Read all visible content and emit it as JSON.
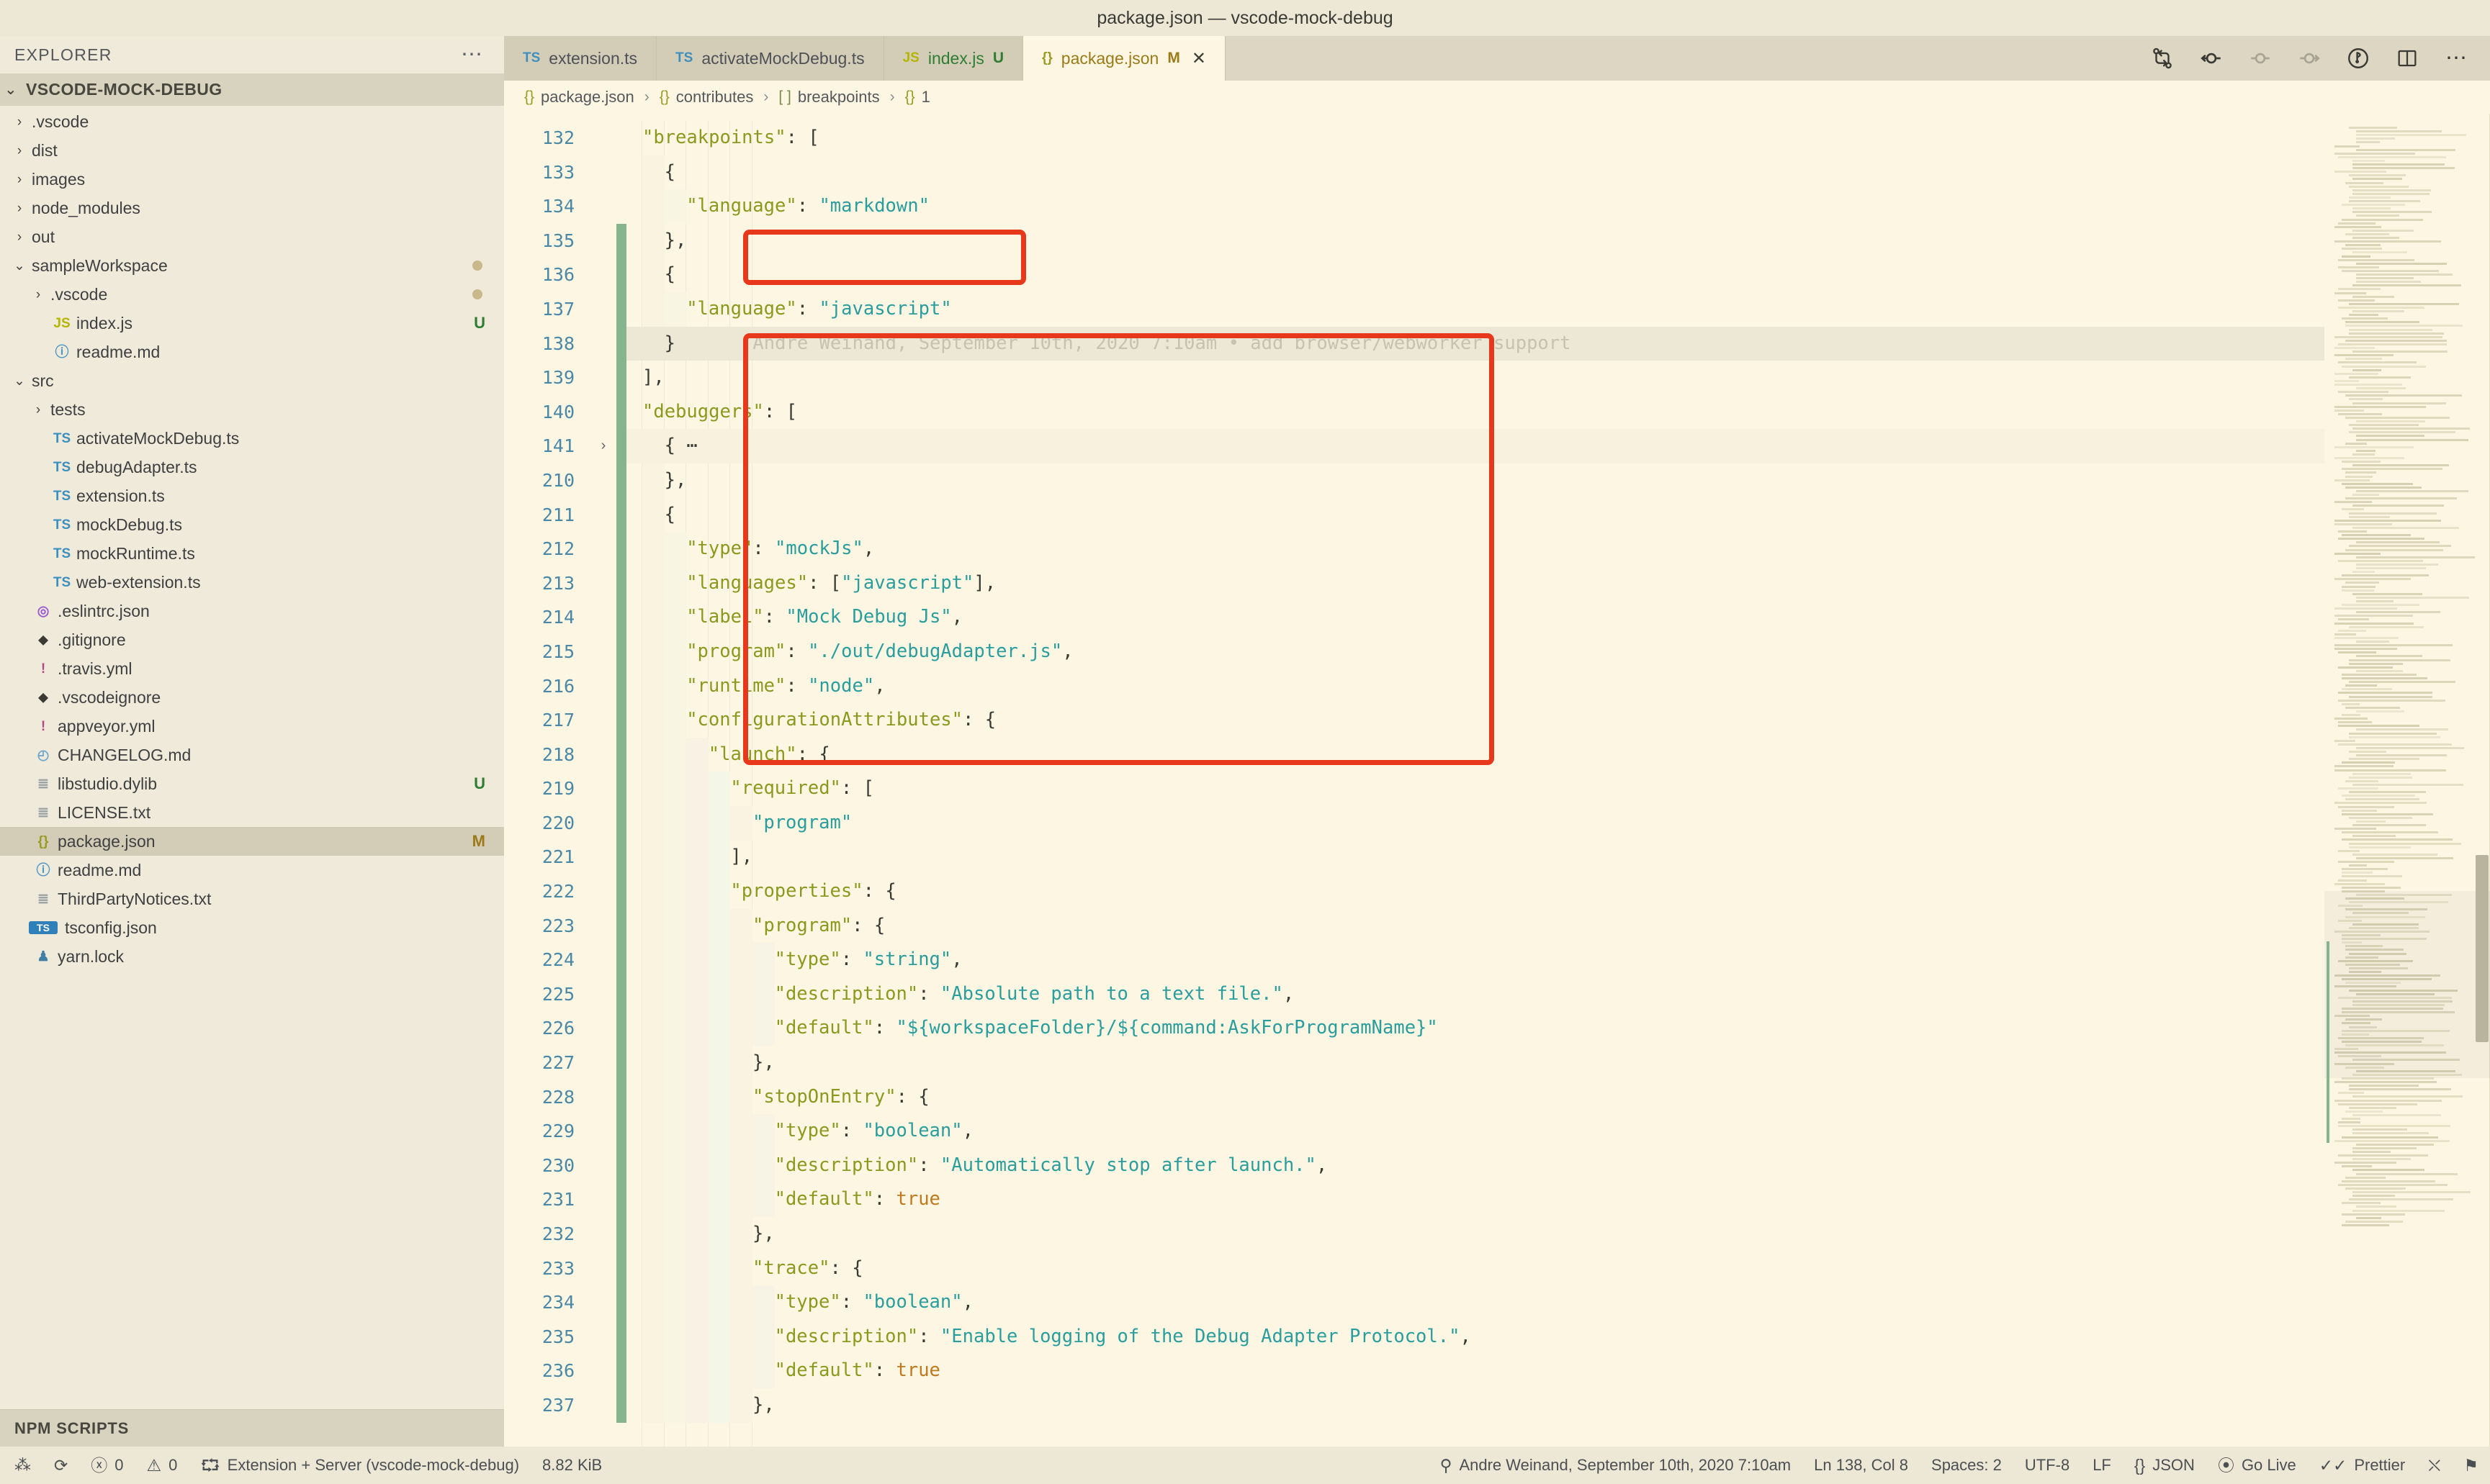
{
  "window": {
    "title": "package.json — vscode-mock-debug"
  },
  "sidebar": {
    "header": {
      "title": "EXPLORER",
      "more_icon": "ellipsis-icon"
    },
    "root": {
      "label": "VSCODE-MOCK-DEBUG",
      "twisty": "⌄"
    },
    "items": [
      {
        "twisty": "›",
        "icon": "folder-icon",
        "icon_glyph": "",
        "label": ".vscode",
        "indent": 0,
        "badge": ""
      },
      {
        "twisty": "›",
        "icon": "folder-icon",
        "icon_glyph": "",
        "label": "dist",
        "indent": 0,
        "badge": ""
      },
      {
        "twisty": "›",
        "icon": "folder-icon",
        "icon_glyph": "",
        "label": "images",
        "indent": 0,
        "badge": ""
      },
      {
        "twisty": "›",
        "icon": "folder-icon",
        "icon_glyph": "",
        "label": "node_modules",
        "indent": 0,
        "badge": ""
      },
      {
        "twisty": "›",
        "icon": "folder-icon",
        "icon_glyph": "",
        "label": "out",
        "indent": 0,
        "badge": ""
      },
      {
        "twisty": "⌄",
        "icon": "folder-icon",
        "icon_glyph": "",
        "label": "sampleWorkspace",
        "indent": 0,
        "badge": "dot"
      },
      {
        "twisty": "›",
        "icon": "folder-icon",
        "icon_glyph": "",
        "label": ".vscode",
        "indent": 1,
        "badge": "dot"
      },
      {
        "twisty": "",
        "icon": "js-file-icon",
        "icon_glyph": "JS",
        "label": "index.js",
        "indent": 1,
        "badge": "U"
      },
      {
        "twisty": "",
        "icon": "markdown-file-icon",
        "icon_glyph": "ⓘ",
        "label": "readme.md",
        "indent": 1,
        "badge": ""
      },
      {
        "twisty": "⌄",
        "icon": "folder-icon",
        "icon_glyph": "",
        "label": "src",
        "indent": 0,
        "badge": ""
      },
      {
        "twisty": "›",
        "icon": "folder-icon",
        "icon_glyph": "",
        "label": "tests",
        "indent": 1,
        "badge": ""
      },
      {
        "twisty": "",
        "icon": "typescript-file-icon",
        "icon_glyph": "TS",
        "label": "activateMockDebug.ts",
        "indent": 1,
        "badge": ""
      },
      {
        "twisty": "",
        "icon": "typescript-file-icon",
        "icon_glyph": "TS",
        "label": "debugAdapter.ts",
        "indent": 1,
        "badge": ""
      },
      {
        "twisty": "",
        "icon": "typescript-file-icon",
        "icon_glyph": "TS",
        "label": "extension.ts",
        "indent": 1,
        "badge": ""
      },
      {
        "twisty": "",
        "icon": "typescript-file-icon",
        "icon_glyph": "TS",
        "label": "mockDebug.ts",
        "indent": 1,
        "badge": ""
      },
      {
        "twisty": "",
        "icon": "typescript-file-icon",
        "icon_glyph": "TS",
        "label": "mockRuntime.ts",
        "indent": 1,
        "badge": ""
      },
      {
        "twisty": "",
        "icon": "typescript-file-icon",
        "icon_glyph": "TS",
        "label": "web-extension.ts",
        "indent": 1,
        "badge": ""
      },
      {
        "twisty": "",
        "icon": "eslint-file-icon",
        "icon_glyph": "◎",
        "label": ".eslintrc.json",
        "indent": 0,
        "badge": ""
      },
      {
        "twisty": "",
        "icon": "git-file-icon",
        "icon_glyph": "⬥",
        "label": ".gitignore",
        "indent": 0,
        "badge": ""
      },
      {
        "twisty": "",
        "icon": "yaml-file-icon",
        "icon_glyph": "!",
        "label": ".travis.yml",
        "indent": 0,
        "badge": ""
      },
      {
        "twisty": "",
        "icon": "git-file-icon",
        "icon_glyph": "⬥",
        "label": ".vscodeignore",
        "indent": 0,
        "badge": ""
      },
      {
        "twisty": "",
        "icon": "yaml-file-icon",
        "icon_glyph": "!",
        "label": "appveyor.yml",
        "indent": 0,
        "badge": ""
      },
      {
        "twisty": "",
        "icon": "changelog-file-icon",
        "icon_glyph": "◴",
        "label": "CHANGELOG.md",
        "indent": 0,
        "badge": ""
      },
      {
        "twisty": "",
        "icon": "binary-file-icon",
        "icon_glyph": "≣",
        "label": "libstudio.dylib",
        "indent": 0,
        "badge": "U"
      },
      {
        "twisty": "",
        "icon": "text-file-icon",
        "icon_glyph": "≣",
        "label": "LICENSE.txt",
        "indent": 0,
        "badge": ""
      },
      {
        "twisty": "",
        "icon": "json-file-icon",
        "icon_glyph": "{}",
        "label": "package.json",
        "indent": 0,
        "badge": "M"
      },
      {
        "twisty": "",
        "icon": "markdown-file-icon",
        "icon_glyph": "ⓘ",
        "label": "readme.md",
        "indent": 0,
        "badge": ""
      },
      {
        "twisty": "",
        "icon": "text-file-icon",
        "icon_glyph": "≣",
        "label": "ThirdPartyNotices.txt",
        "indent": 0,
        "badge": ""
      },
      {
        "twisty": "",
        "icon": "tsconfig-file-icon",
        "icon_glyph": "TS",
        "label": "tsconfig.json",
        "indent": 0,
        "badge": ""
      },
      {
        "twisty": "",
        "icon": "yarn-file-icon",
        "icon_glyph": "♟",
        "label": "yarn.lock",
        "indent": 0,
        "badge": ""
      }
    ],
    "npm_scripts": {
      "label": "NPM SCRIPTS"
    }
  },
  "tabs": [
    {
      "icon": "typescript-file-icon",
      "icon_glyph": "TS",
      "label": "extension.ts",
      "modifier": "",
      "active": false,
      "closable": false
    },
    {
      "icon": "typescript-file-icon",
      "icon_glyph": "TS",
      "label": "activateMockDebug.ts",
      "modifier": "",
      "active": false,
      "closable": false
    },
    {
      "icon": "js-file-icon",
      "icon_glyph": "JS",
      "label": "index.js",
      "modifier": "U",
      "active": false,
      "closable": false
    },
    {
      "icon": "json-file-icon",
      "icon_glyph": "{}",
      "label": "package.json",
      "modifier": "M",
      "active": true,
      "closable": true,
      "close_glyph": "✕"
    }
  ],
  "editor_actions": [
    {
      "name": "compare-changes-icon"
    },
    {
      "name": "previous-change-icon"
    },
    {
      "name": "current-change-icon"
    },
    {
      "name": "next-change-icon"
    },
    {
      "name": "toggle-blame-icon"
    },
    {
      "name": "split-editor-icon"
    },
    {
      "name": "more-actions-icon"
    }
  ],
  "breadcrumbs": [
    {
      "icon_glyph": "{}",
      "label": "package.json",
      "kind": "json"
    },
    {
      "icon_glyph": "{}",
      "label": "contributes",
      "kind": "json"
    },
    {
      "icon_glyph": "[ ]",
      "label": "breakpoints",
      "kind": "array"
    },
    {
      "icon_glyph": "{}",
      "label": "1",
      "kind": "json"
    }
  ],
  "breadcrumb_separator": "›",
  "editor": {
    "file": "package.json",
    "language": "JSON",
    "first_line": 132,
    "lines": [
      {
        "n": 132,
        "indent": 1,
        "text": "\"breakpoints\": ["
      },
      {
        "n": 133,
        "indent": 2,
        "text": "{"
      },
      {
        "n": 134,
        "indent": 3,
        "text": "\"language\": \"markdown\""
      },
      {
        "n": 135,
        "indent": 2,
        "text": "},"
      },
      {
        "n": 136,
        "indent": 2,
        "text": "{"
      },
      {
        "n": 137,
        "indent": 3,
        "text": "\"language\": \"javascript\""
      },
      {
        "n": 138,
        "indent": 2,
        "text": "}"
      },
      {
        "n": 139,
        "indent": 1,
        "text": "],"
      },
      {
        "n": 140,
        "indent": 1,
        "text": "\"debuggers\": ["
      },
      {
        "n": 141,
        "indent": 2,
        "text": "{ ⋯"
      },
      {
        "n": 210,
        "indent": 2,
        "text": "},"
      },
      {
        "n": 211,
        "indent": 2,
        "text": "{"
      },
      {
        "n": 212,
        "indent": 3,
        "text": "\"type\": \"mockJs\","
      },
      {
        "n": 213,
        "indent": 3,
        "text": "\"languages\": [\"javascript\"],"
      },
      {
        "n": 214,
        "indent": 3,
        "text": "\"label\": \"Mock Debug Js\","
      },
      {
        "n": 215,
        "indent": 3,
        "text": "\"program\": \"./out/debugAdapter.js\","
      },
      {
        "n": 216,
        "indent": 3,
        "text": "\"runtime\": \"node\","
      },
      {
        "n": 217,
        "indent": 3,
        "text": "\"configurationAttributes\": {"
      },
      {
        "n": 218,
        "indent": 4,
        "text": "\"launch\": {"
      },
      {
        "n": 219,
        "indent": 5,
        "text": "\"required\": ["
      },
      {
        "n": 220,
        "indent": 6,
        "text": "\"program\""
      },
      {
        "n": 221,
        "indent": 5,
        "text": "],"
      },
      {
        "n": 222,
        "indent": 5,
        "text": "\"properties\": {"
      },
      {
        "n": 223,
        "indent": 6,
        "text": "\"program\": {"
      },
      {
        "n": 224,
        "indent": 7,
        "text": "\"type\": \"string\","
      },
      {
        "n": 225,
        "indent": 7,
        "text": "\"description\": \"Absolute path to a text file.\","
      },
      {
        "n": 226,
        "indent": 7,
        "text": "\"default\": \"${workspaceFolder}/${command:AskForProgramName}\""
      },
      {
        "n": 227,
        "indent": 6,
        "text": "},"
      },
      {
        "n": 228,
        "indent": 6,
        "text": "\"stopOnEntry\": {"
      },
      {
        "n": 229,
        "indent": 7,
        "text": "\"type\": \"boolean\","
      },
      {
        "n": 230,
        "indent": 7,
        "text": "\"description\": \"Automatically stop after launch.\","
      },
      {
        "n": 231,
        "indent": 7,
        "text": "\"default\": true"
      },
      {
        "n": 232,
        "indent": 6,
        "text": "},"
      },
      {
        "n": 233,
        "indent": 6,
        "text": "\"trace\": {"
      },
      {
        "n": 234,
        "indent": 7,
        "text": "\"type\": \"boolean\","
      },
      {
        "n": 235,
        "indent": 7,
        "text": "\"description\": \"Enable logging of the Debug Adapter Protocol.\","
      },
      {
        "n": 236,
        "indent": 7,
        "text": "\"default\": true"
      },
      {
        "n": 237,
        "indent": 6,
        "text": "},"
      }
    ],
    "blame_annotation": {
      "line": 138,
      "text": "Andre Weinand, September 10th, 2020 7:10am • add browser/webworker support"
    },
    "fold_marker_line": 141,
    "fold_glyph": "›"
  },
  "annotations": {
    "box1_label": "breakpoints-javascript-entry",
    "box2_label": "mockJs-debugger-entry",
    "color": "#E8381B"
  },
  "statusbar": {
    "left": [
      {
        "name": "remote-indicator-icon",
        "glyph": "⁂",
        "text": ""
      },
      {
        "name": "sync-changes-icon",
        "glyph": "⟳",
        "text": ""
      },
      {
        "name": "errors-count",
        "glyph": "ⓧ",
        "text": "0"
      },
      {
        "name": "warnings-count",
        "glyph": "⚠",
        "text": "0"
      },
      {
        "name": "debug-session",
        "glyph": "⮔",
        "text": "Extension + Server (vscode-mock-debug)"
      },
      {
        "name": "file-size",
        "glyph": "",
        "text": "8.82 KiB"
      }
    ],
    "right": [
      {
        "name": "git-blame",
        "glyph": "⚲",
        "text": "Andre Weinand, September 10th, 2020 7:10am"
      },
      {
        "name": "cursor-position",
        "glyph": "",
        "text": "Ln 138, Col 8"
      },
      {
        "name": "indentation",
        "glyph": "",
        "text": "Spaces: 2"
      },
      {
        "name": "encoding",
        "glyph": "",
        "text": "UTF-8"
      },
      {
        "name": "eol-sequence",
        "glyph": "",
        "text": "LF"
      },
      {
        "name": "language-mode",
        "glyph": "{}",
        "text": "JSON"
      },
      {
        "name": "go-live",
        "glyph": "⦿",
        "text": "Go Live"
      },
      {
        "name": "prettier",
        "glyph": "✓✓",
        "text": "Prettier"
      },
      {
        "name": "live-share",
        "glyph": "⛌",
        "text": ""
      },
      {
        "name": "notifications-bell",
        "glyph": "⚑",
        "text": ""
      }
    ]
  },
  "theme": {
    "editor_bg": "#FDF6E3",
    "sidebar_bg": "#EFEADA",
    "chrome_bg": "#EDE8D5",
    "tab_inactive": "#D3CDB7",
    "accent_key": "#8a9a1f",
    "accent_string": "#2a9d9d",
    "accent_bool": "#C07A1E",
    "line_number": "#4a88a6",
    "annotation_red": "#E8381B"
  }
}
